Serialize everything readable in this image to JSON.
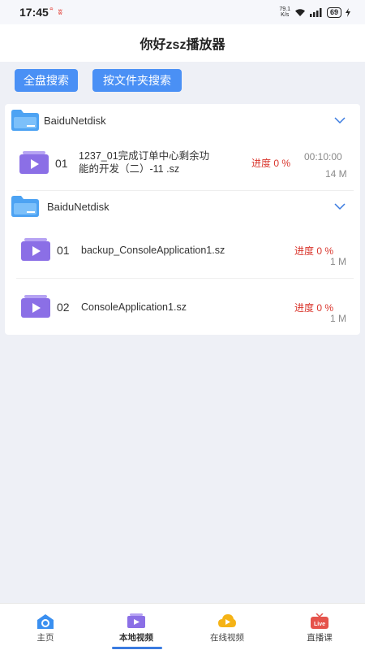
{
  "status_bar": {
    "time": "17:45",
    "net_speed_value": "79.1",
    "net_speed_unit": "K/s",
    "battery": "69"
  },
  "header": {
    "title": "你好zsz播放器"
  },
  "actions": {
    "search_all_label": "全盘搜索",
    "search_folder_label": "按文件夹搜索"
  },
  "folders": [
    {
      "name": "BaiduNetdisk",
      "videos": [
        {
          "index": "01",
          "name_line1": "1237_01完成订单中心剩余功",
          "name_line2": "能的开发（二）-11 .sz",
          "progress": "进度 0 %",
          "duration": "00:10:00",
          "size": "14 M"
        }
      ]
    },
    {
      "name": "BaiduNetdisk",
      "videos": [
        {
          "index": "01",
          "name_line1": "backup_ConsoleApplication1.sz",
          "progress": "进度 0 %",
          "size": "1 M"
        },
        {
          "index": "02",
          "name_line1": "ConsoleApplication1.sz",
          "progress": "进度 0 %",
          "size": "1 M"
        }
      ]
    }
  ],
  "bottom_nav": [
    {
      "label": "主页",
      "icon": "home-icon",
      "active": false
    },
    {
      "label": "本地视频",
      "icon": "local-video-icon",
      "active": true
    },
    {
      "label": "在线视频",
      "icon": "online-video-icon",
      "active": false
    },
    {
      "label": "直播课",
      "icon": "live-class-icon",
      "active": false,
      "badge": "Live"
    }
  ],
  "colors": {
    "accent": "#4a90f5",
    "progress": "#d9342b",
    "folder": "#4da3f3",
    "video_icon": "#8b6fe6"
  }
}
